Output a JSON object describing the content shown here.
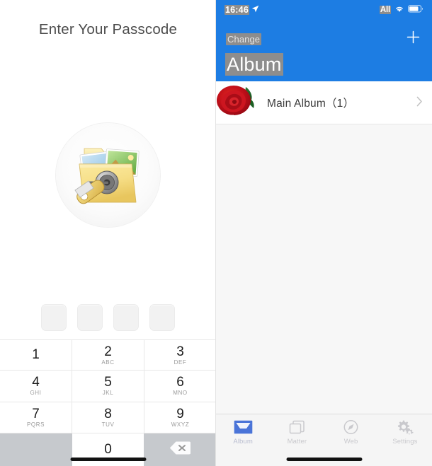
{
  "passcode_panel": {
    "title": "Enter Your Passcode",
    "icon_name": "locked-folder-icon",
    "dots": [
      "",
      "",
      "",
      ""
    ],
    "keypad": {
      "keys": [
        {
          "digit": "1",
          "letters": ""
        },
        {
          "digit": "2",
          "letters": "ABC"
        },
        {
          "digit": "3",
          "letters": "DEF"
        },
        {
          "digit": "4",
          "letters": "GHI"
        },
        {
          "digit": "5",
          "letters": "JKL"
        },
        {
          "digit": "6",
          "letters": "MNO"
        },
        {
          "digit": "7",
          "letters": "PQRS"
        },
        {
          "digit": "8",
          "letters": "TUV"
        },
        {
          "digit": "9",
          "letters": "WXYZ"
        }
      ],
      "zero": {
        "digit": "0",
        "letters": ""
      },
      "delete_label": "delete-key"
    }
  },
  "album_panel": {
    "status_bar": {
      "time": "16:46",
      "location_icon": "location-arrow-icon",
      "carrier": "All",
      "wifi_icon": "wifi-icon",
      "battery_icon": "battery-icon"
    },
    "nav": {
      "change_label": "Change",
      "add_icon": "plus-icon",
      "title": "Album"
    },
    "list": [
      {
        "thumbnail": "red-rose-photo",
        "name": "Main Album（1）",
        "chevron_icon": "chevron-right-icon"
      }
    ],
    "tabs": [
      {
        "label": "Album",
        "icon": "album-tray-icon",
        "active": true
      },
      {
        "label": "Matter",
        "icon": "stacked-squares-icon",
        "active": false
      },
      {
        "label": "Web",
        "icon": "compass-icon",
        "active": false
      },
      {
        "label": "Settings",
        "icon": "gears-icon",
        "active": false
      }
    ]
  },
  "colors": {
    "nav_blue": "#1d7de3",
    "keypad_gray": "#c6c9cd",
    "content_gray": "#f7f7f7",
    "tab_active": "#4a74d8"
  }
}
